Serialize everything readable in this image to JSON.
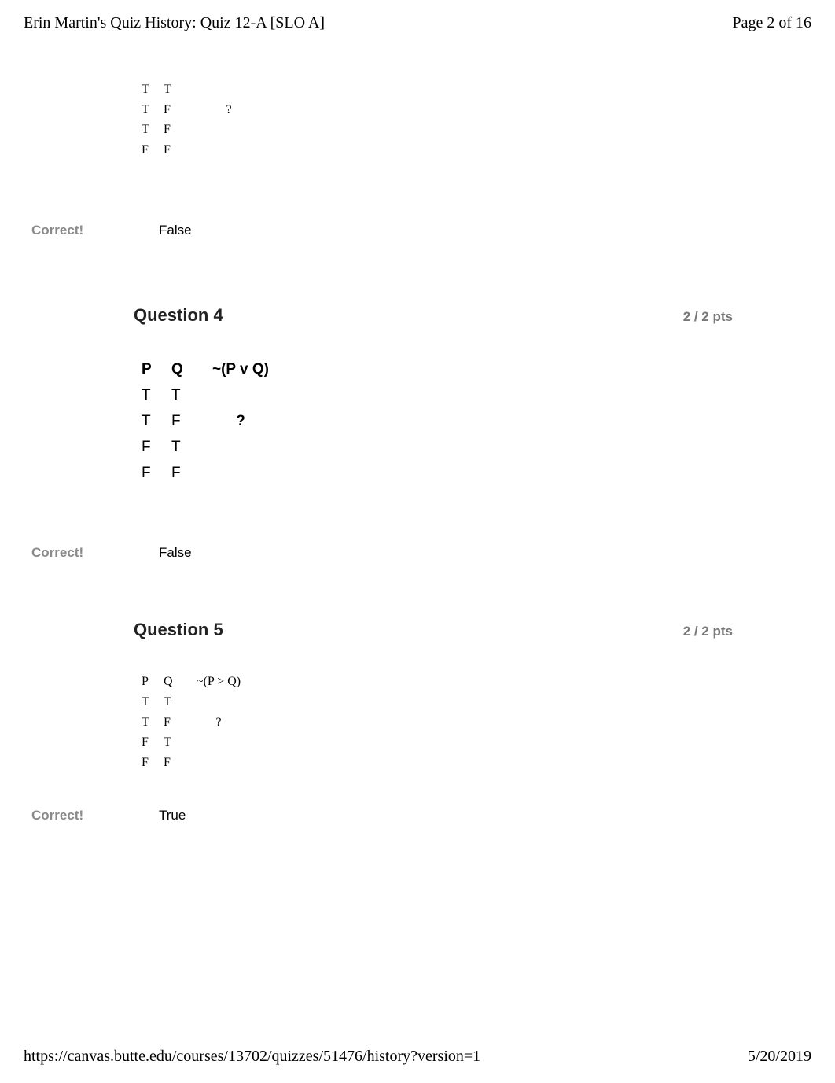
{
  "header": {
    "title": "Erin Martin's Quiz History: Quiz 12-A [SLO A]",
    "page": "Page 2 of 16"
  },
  "q3_tail": {
    "rows": [
      {
        "p": "T",
        "q": "T",
        "v": ""
      },
      {
        "p": "T",
        "q": "F",
        "v": "?"
      },
      {
        "p": "T",
        "q": "F",
        "v": ""
      },
      {
        "p": "F",
        "q": "F",
        "v": ""
      }
    ],
    "correct_label": "Correct!",
    "answer": "False"
  },
  "q4": {
    "title": "Question 4",
    "points": "2 / 2 pts",
    "table": {
      "head": {
        "p": "P",
        "q": "Q",
        "expr": "~(P v Q)"
      },
      "rows": [
        {
          "p": "T",
          "q": "T",
          "v": ""
        },
        {
          "p": "T",
          "q": "F",
          "v": "?"
        },
        {
          "p": "F",
          "q": "T",
          "v": ""
        },
        {
          "p": "F",
          "q": "F",
          "v": ""
        }
      ]
    },
    "correct_label": "Correct!",
    "answer": "False"
  },
  "q5": {
    "title": "Question 5",
    "points": "2 / 2 pts",
    "table": {
      "head": {
        "p": "P",
        "q": "Q",
        "expr": "~(P > Q)"
      },
      "rows": [
        {
          "p": "T",
          "q": "T",
          "v": ""
        },
        {
          "p": "T",
          "q": "F",
          "v": "?"
        },
        {
          "p": "F",
          "q": "T",
          "v": ""
        },
        {
          "p": "F",
          "q": "F",
          "v": ""
        }
      ]
    },
    "correct_label": "Correct!",
    "answer": "True"
  },
  "footer": {
    "url": "https://canvas.butte.edu/courses/13702/quizzes/51476/history?version=1",
    "date": "5/20/2019"
  }
}
